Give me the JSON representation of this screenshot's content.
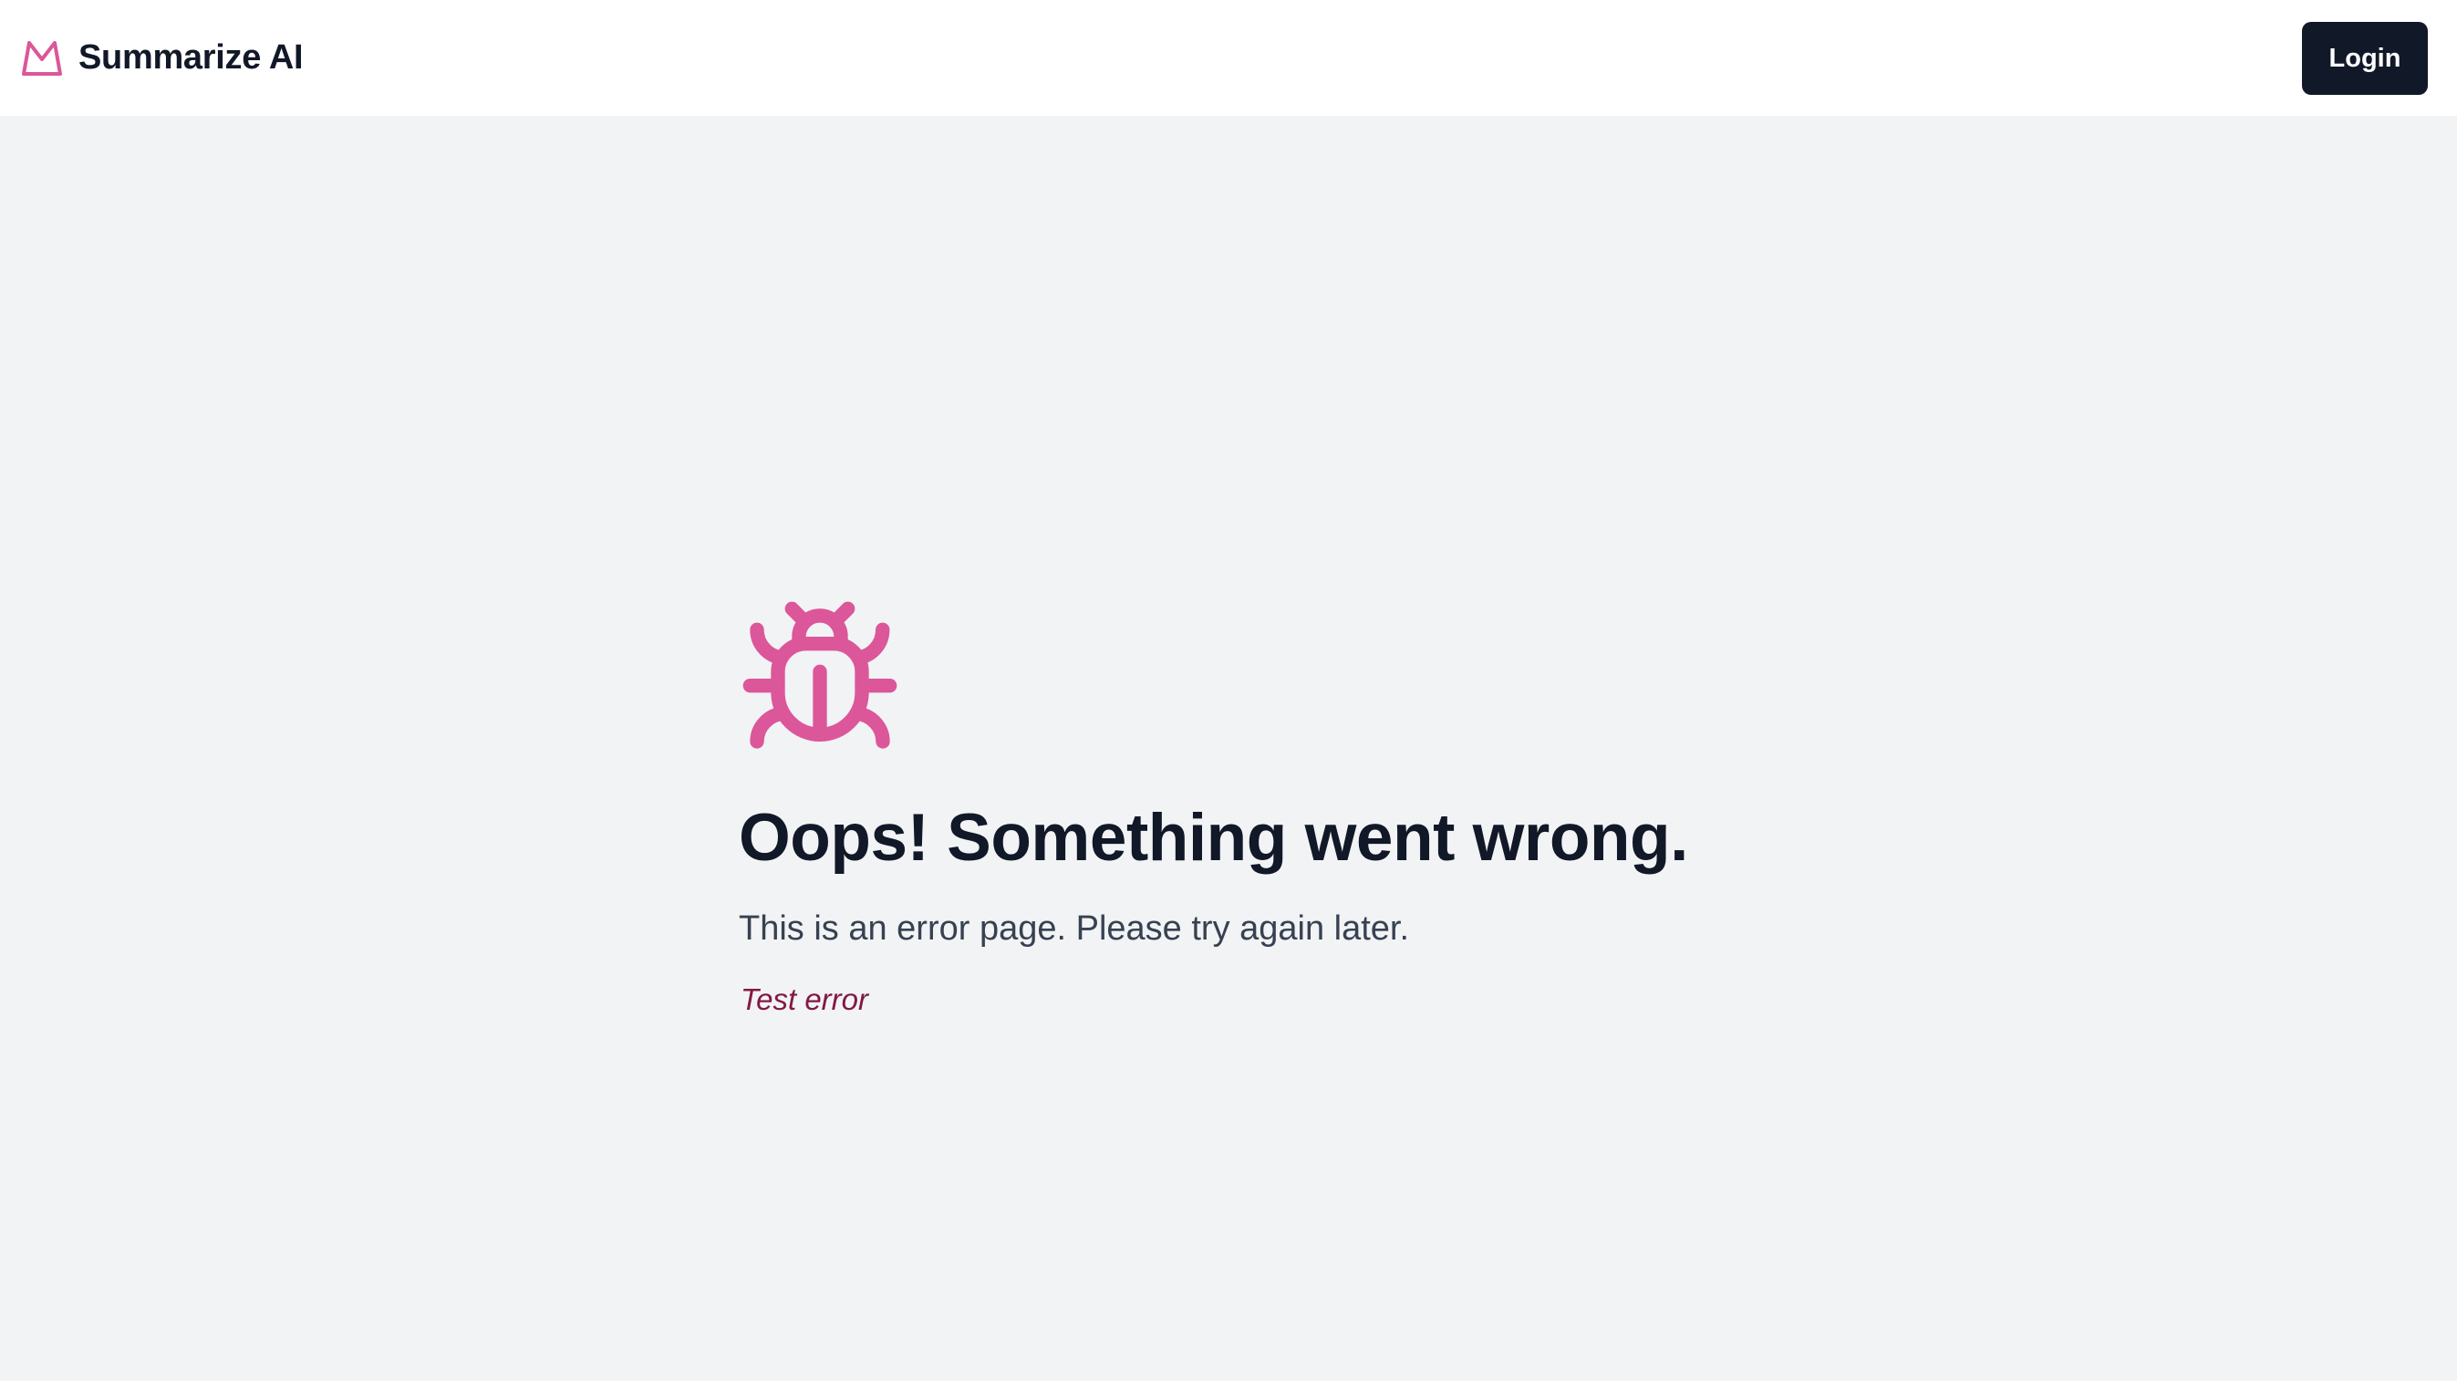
{
  "header": {
    "brand_name": "Summarize AI",
    "logo_icon": "crown-icon",
    "login_label": "Login"
  },
  "error": {
    "icon": "bug-icon",
    "title": "Oops! Something went wrong.",
    "message": "This is an error page. Please try again later.",
    "detail": "Test error"
  },
  "colors": {
    "accent": "#db5799",
    "heading": "#111827",
    "body_text": "#374151",
    "error_detail": "#831843",
    "page_background": "#f2f3f5",
    "header_background": "#ffffff",
    "button_background": "#111827"
  }
}
